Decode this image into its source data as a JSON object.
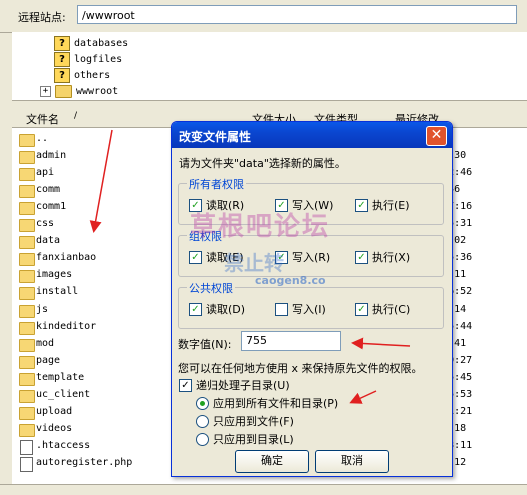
{
  "remote": {
    "label": "远程站点:",
    "path": "/wwwroot"
  },
  "tree": {
    "items": [
      "databases",
      "logfiles",
      "others",
      "wwwroot"
    ],
    "expander": "+"
  },
  "file_header": {
    "name": "文件名",
    "sort_arrow": "/",
    "size": "文件大小",
    "type": "文件类型",
    "modified": "最近修改"
  },
  "files": [
    {
      "name": "..",
      "time": "",
      "kind": "folder"
    },
    {
      "name": "admin",
      "time": "3:32:30",
      "kind": "folder"
    },
    {
      "name": "api",
      "time": "22:02:46",
      "kind": "folder"
    },
    {
      "name": "comm",
      "time": ":32:46",
      "kind": "folder"
    },
    {
      "name": "comm1",
      "time": "17:07:16",
      "kind": "folder"
    },
    {
      "name": "css",
      "time": "12:45:31",
      "kind": "folder"
    },
    {
      "name": "data",
      "time": "1:19:02",
      "kind": "folder"
    },
    {
      "name": "fanxianbao",
      "time": "22:05:36",
      "kind": "folder"
    },
    {
      "name": "images",
      "time": "7:48:11",
      "kind": "folder"
    },
    {
      "name": "install",
      "time": "22:06:52",
      "kind": "folder"
    },
    {
      "name": "js",
      "time": "7:31:14",
      "kind": "folder"
    },
    {
      "name": "kindeditor",
      "time": "12:45:44",
      "kind": "folder"
    },
    {
      "name": "mod",
      "time": "7:48:41",
      "kind": "folder"
    },
    {
      "name": "page",
      "time": "22:09:27",
      "kind": "folder"
    },
    {
      "name": "template",
      "time": "12:45:45",
      "kind": "folder"
    },
    {
      "name": "uc_client",
      "time": "12:45:53",
      "kind": "folder"
    },
    {
      "name": "upload",
      "time": "22:11:21",
      "kind": "folder"
    },
    {
      "name": "videos",
      "time": "1:16:18",
      "kind": "folder"
    },
    {
      "name": ".htaccess",
      "time": "16:13:11",
      "kind": "file"
    },
    {
      "name": "autoregister.php",
      "time": "7:49:12",
      "kind": "file"
    }
  ],
  "dialog": {
    "title": "改变文件属性",
    "close": "✕",
    "prompt": "请为文件夹\"data\"选择新的属性。",
    "groups": [
      {
        "label": "所有者权限",
        "read": "读取(R)",
        "write": "写入(W)",
        "exec": "执行(E)",
        "read_on": true,
        "write_on": true,
        "exec_on": true
      },
      {
        "label": "组权限",
        "read": "读取(E)",
        "write": "写入(R)",
        "exec": "执行(X)",
        "read_on": true,
        "write_on": true,
        "exec_on": true
      },
      {
        "label": "公共权限",
        "read": "读取(D)",
        "write": "写入(I)",
        "exec": "执行(C)",
        "read_on": true,
        "write_on": false,
        "exec_on": true
      }
    ],
    "numeric_label": "数字值(N):",
    "numeric_value": "755",
    "hint": "您可以在任何地方使用 x 来保持原先文件的权限。",
    "recurse_label": "递归处理子目录(U)",
    "recurse_on": true,
    "apply_options": [
      "应用到所有文件和目录(P)",
      "只应用到文件(F)",
      "只应用到目录(L)"
    ],
    "apply_selected": 0,
    "ok": "确定",
    "cancel": "取消"
  },
  "watermark": {
    "line1": "草根吧论坛",
    "line2": "禁止转",
    "line3": "caogen8.co"
  },
  "colors": {
    "annotation_arrow": "#e02020",
    "dialog_title": "#0a46d0",
    "check": "#21a121"
  }
}
